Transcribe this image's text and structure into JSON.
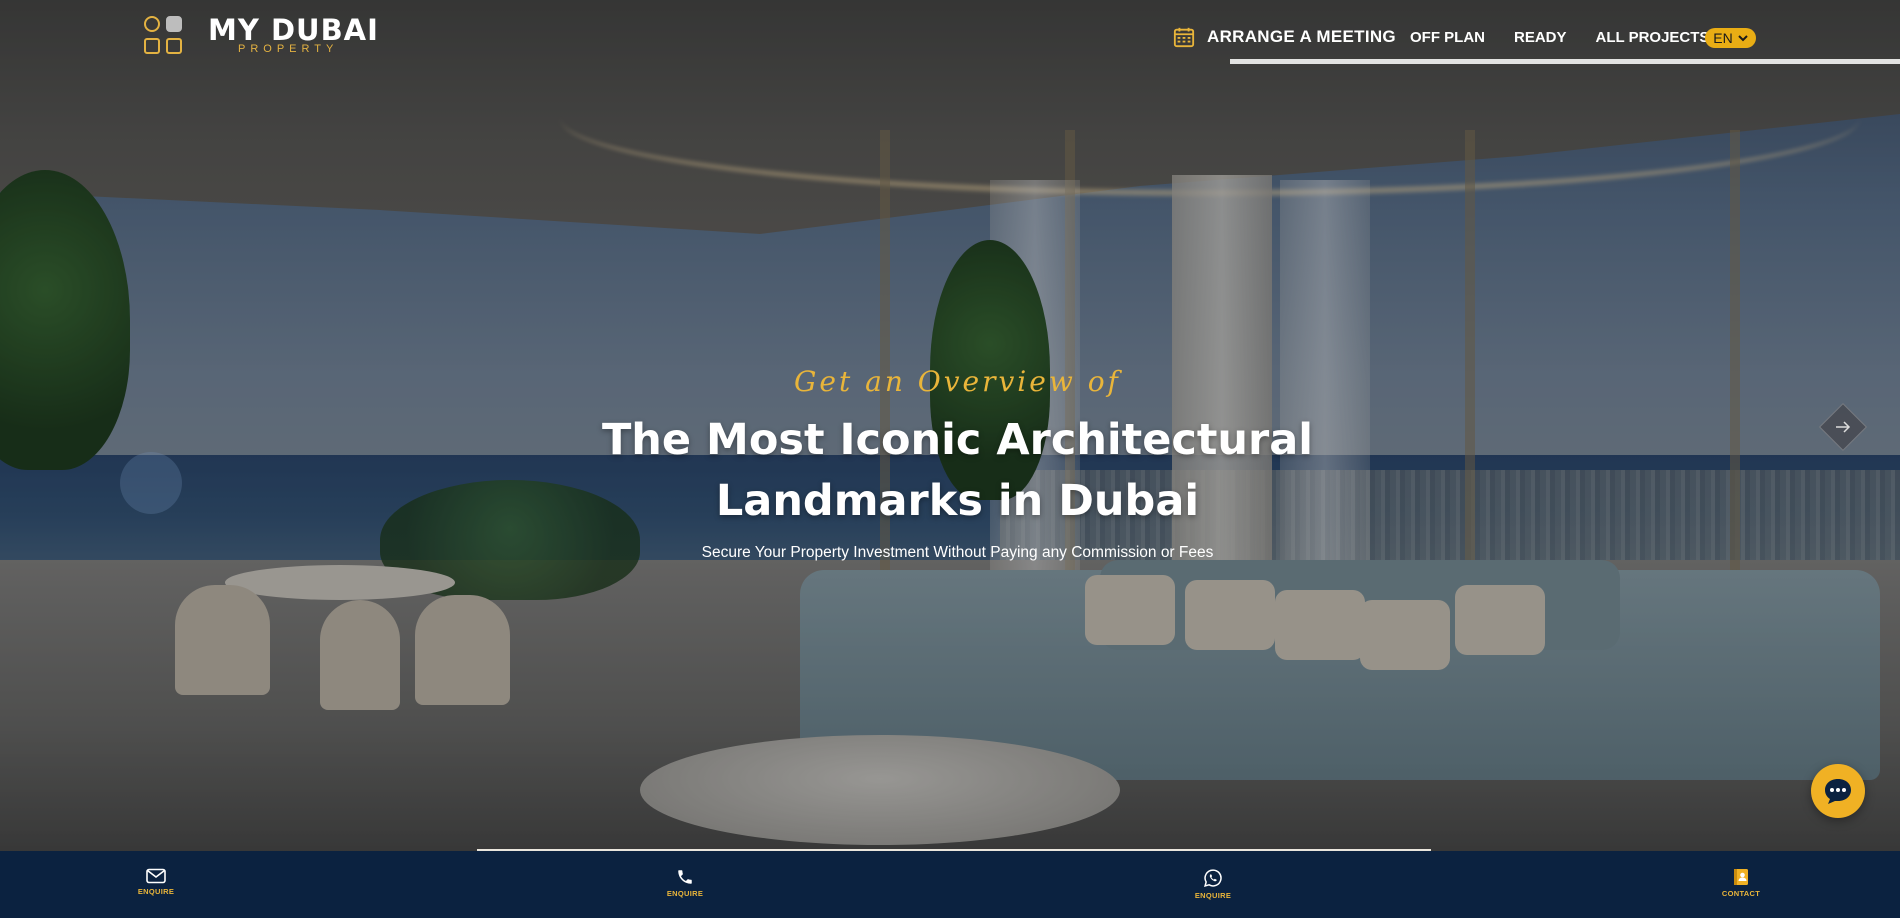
{
  "header": {
    "logo": {
      "title": "MY DUBAI",
      "subtitle": "PROPERTY"
    },
    "meeting_label": "ARRANGE A MEETING",
    "nav": [
      "OFF PLAN",
      "READY",
      "ALL PROJECTS"
    ],
    "language": "EN"
  },
  "hero": {
    "eyebrow": "Get an Overview of",
    "title_line1": "The Most Iconic Architectural",
    "title_line2": "Landmarks in Dubai",
    "subtitle": "Secure Your Property Investment Without Paying any Commission or Fees"
  },
  "bottom_bar": {
    "items": [
      {
        "label": "ENQUIRE",
        "icon": "mail-icon"
      },
      {
        "label": "ENQUIRE",
        "icon": "phone-icon"
      },
      {
        "label": "ENQUIRE",
        "icon": "whatsapp-icon"
      },
      {
        "label": "CONTACT",
        "icon": "contact-book-icon"
      }
    ]
  },
  "colors": {
    "accent": "#e9b53a",
    "bar": "#0b2240",
    "chat": "#f0b124"
  }
}
